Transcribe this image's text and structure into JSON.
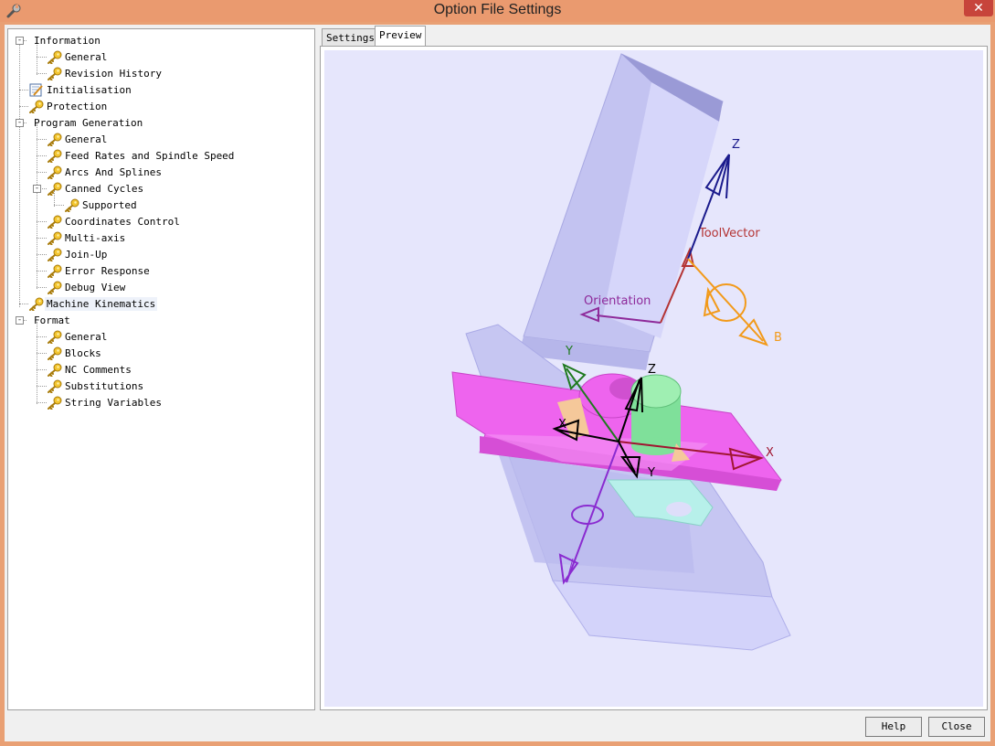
{
  "window": {
    "title": "Option File Settings",
    "close_glyph": "✕",
    "icon": "wrench-icon"
  },
  "tree": {
    "items": [
      {
        "label": "Information",
        "level": 0,
        "expander": "-",
        "icon": "none"
      },
      {
        "label": "General",
        "level": 1,
        "icon": "key-icon"
      },
      {
        "label": "Revision History",
        "level": 1,
        "icon": "key-icon"
      },
      {
        "label": "Initialisation",
        "level": 0,
        "icon": "edit-document-icon"
      },
      {
        "label": "Protection",
        "level": 0,
        "icon": "key-icon"
      },
      {
        "label": "Program Generation",
        "level": 0,
        "expander": "-",
        "icon": "none"
      },
      {
        "label": "General",
        "level": 1,
        "icon": "key-icon"
      },
      {
        "label": "Feed Rates and Spindle Speed",
        "level": 1,
        "icon": "key-icon"
      },
      {
        "label": "Arcs And Splines",
        "level": 1,
        "icon": "key-icon"
      },
      {
        "label": "Canned Cycles",
        "level": 1,
        "expander": "-",
        "icon": "key-icon"
      },
      {
        "label": "Supported",
        "level": 2,
        "icon": "key-icon"
      },
      {
        "label": "Coordinates Control",
        "level": 1,
        "icon": "key-icon"
      },
      {
        "label": "Multi-axis",
        "level": 1,
        "icon": "key-icon"
      },
      {
        "label": "Join-Up",
        "level": 1,
        "icon": "key-icon"
      },
      {
        "label": "Error Response",
        "level": 1,
        "icon": "key-icon"
      },
      {
        "label": "Debug View",
        "level": 1,
        "icon": "key-icon"
      },
      {
        "label": "Machine Kinematics",
        "level": 0,
        "icon": "key-icon",
        "selected": true
      },
      {
        "label": "Format",
        "level": 0,
        "expander": "-",
        "icon": "none"
      },
      {
        "label": "General",
        "level": 1,
        "icon": "key-icon"
      },
      {
        "label": "Blocks",
        "level": 1,
        "icon": "key-icon"
      },
      {
        "label": "NC Comments",
        "level": 1,
        "icon": "key-icon"
      },
      {
        "label": "Substitutions",
        "level": 1,
        "icon": "key-icon"
      },
      {
        "label": "String Variables",
        "level": 1,
        "icon": "key-icon"
      }
    ]
  },
  "tabs": {
    "settings": "Settings",
    "preview": "Preview",
    "active": "Preview"
  },
  "preview": {
    "labels": {
      "tool_z": "Z",
      "tool_vector": "ToolVector",
      "orientation": "Orientation",
      "b_axis": "B",
      "table_x": "X",
      "table_y": "Y",
      "table_z": "Z",
      "work_x": "X",
      "work_y": "Y"
    },
    "colors": {
      "background": "#e6e6fc",
      "machine_body": "#c3c3f1",
      "table": "#ee64ee",
      "cylinder": "#7fe09a",
      "mount": "#b7f0ea",
      "tool_axis": "#1a1a8c",
      "tool_vector": "#b43434",
      "orientation": "#8e2a9a",
      "b_axis": "#f29a1a",
      "x_axis": "#a01530",
      "y_axis": "#1f7a1f",
      "rotary_axis": "#8a2bd0"
    }
  },
  "buttons": {
    "help": "Help",
    "close": "Close"
  }
}
